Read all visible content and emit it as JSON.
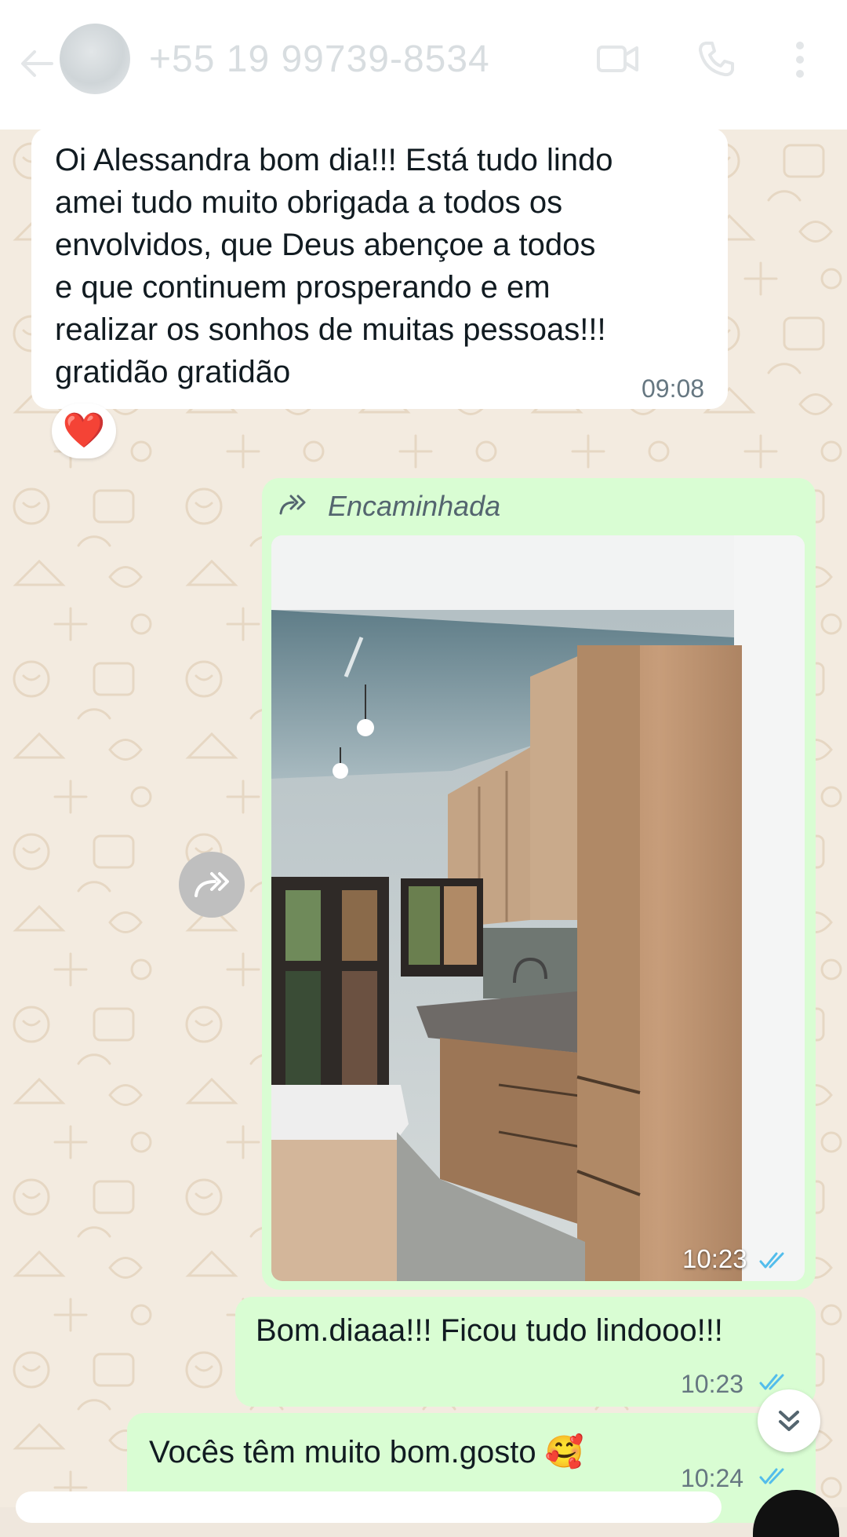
{
  "header": {
    "contact": "+55 19 99739-8534"
  },
  "messages": {
    "m1": {
      "lines": [
        "Oi Alessandra bom dia!!! Está tudo lindo",
        "amei tudo muito obrigada a todos os",
        "envolvidos, que Deus abençoe a todos",
        "e que continuem prosperando e em",
        "realizar os sonhos de muitas pessoas!!!",
        "gratidão gratidão"
      ],
      "time": "09:08",
      "reaction": "❤️"
    },
    "m2": {
      "forwarded_label": "Encaminhada",
      "time": "10:23"
    },
    "m3": {
      "text": "Bom.diaaa!!! Ficou tudo lindooo!!!",
      "time": "10:23"
    },
    "m4": {
      "text": "Vocês têm muito bom.gosto 🥰",
      "time": "10:24"
    }
  },
  "colors": {
    "incoming_bubble": "#ffffff",
    "outgoing_bubble": "#d9fdd3",
    "read_ticks": "#53bdeb",
    "wallpaper": "#f3ebe0"
  }
}
